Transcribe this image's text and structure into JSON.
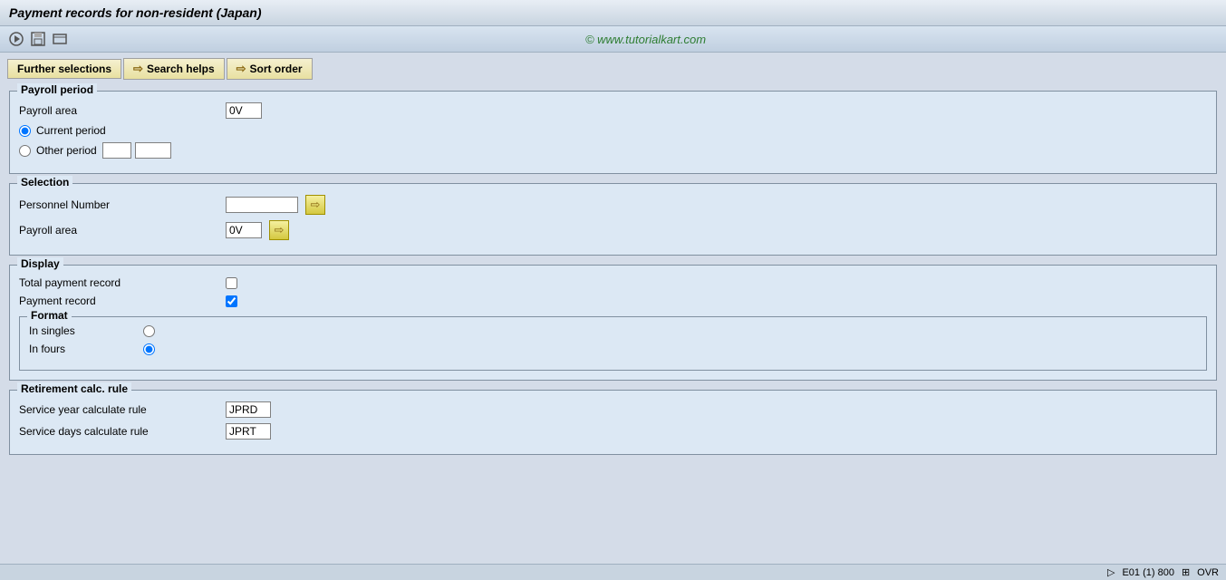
{
  "title": "Payment records for non-resident (Japan)",
  "watermark": "© www.tutorialkart.com",
  "tabs": [
    {
      "label": "Further selections",
      "id": "further-selections"
    },
    {
      "label": "Search helps",
      "id": "search-helps"
    },
    {
      "label": "Sort order",
      "id": "sort-order"
    }
  ],
  "payroll_period_section": {
    "title": "Payroll period",
    "payroll_area_label": "Payroll area",
    "payroll_area_value": "0V",
    "current_period_label": "Current period",
    "other_period_label": "Other period",
    "other_period_value1": "",
    "other_period_value2": ""
  },
  "selection_section": {
    "title": "Selection",
    "personnel_number_label": "Personnel Number",
    "personnel_number_value": "",
    "payroll_area_label": "Payroll area",
    "payroll_area_value": "0V"
  },
  "display_section": {
    "title": "Display",
    "total_payment_label": "Total payment record",
    "total_payment_checked": false,
    "payment_record_label": "Payment record",
    "payment_record_checked": true,
    "format_section": {
      "title": "Format",
      "in_singles_label": "In singles",
      "in_fours_label": "In fours"
    }
  },
  "retirement_section": {
    "title": "Retirement calc. rule",
    "service_year_label": "Service year calculate rule",
    "service_year_value": "JPRD",
    "service_days_label": "Service days calculate rule",
    "service_days_value": "JPRT"
  },
  "status_bar": {
    "left_text": "E01 (1) 800",
    "right_text": "OVR"
  },
  "toolbar_icons": [
    {
      "name": "back-icon",
      "symbol": "⬤"
    },
    {
      "name": "save-icon",
      "symbol": "▦"
    },
    {
      "name": "local-icon",
      "symbol": "▤"
    }
  ],
  "arrow_symbol": "⇨"
}
